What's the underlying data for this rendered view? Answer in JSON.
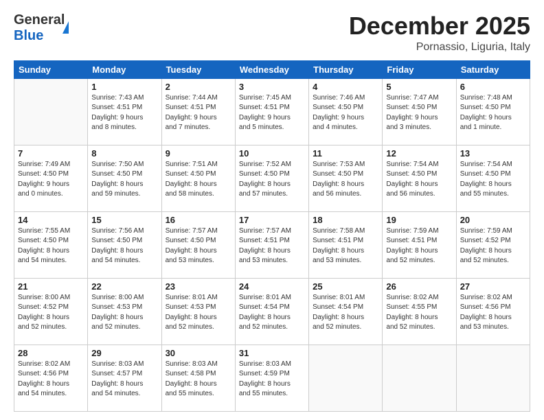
{
  "header": {
    "logo_general": "General",
    "logo_blue": "Blue",
    "month_title": "December 2025",
    "location": "Pornassio, Liguria, Italy"
  },
  "weekdays": [
    "Sunday",
    "Monday",
    "Tuesday",
    "Wednesday",
    "Thursday",
    "Friday",
    "Saturday"
  ],
  "weeks": [
    [
      {
        "day": "",
        "info": ""
      },
      {
        "day": "1",
        "info": "Sunrise: 7:43 AM\nSunset: 4:51 PM\nDaylight: 9 hours\nand 8 minutes."
      },
      {
        "day": "2",
        "info": "Sunrise: 7:44 AM\nSunset: 4:51 PM\nDaylight: 9 hours\nand 7 minutes."
      },
      {
        "day": "3",
        "info": "Sunrise: 7:45 AM\nSunset: 4:51 PM\nDaylight: 9 hours\nand 5 minutes."
      },
      {
        "day": "4",
        "info": "Sunrise: 7:46 AM\nSunset: 4:50 PM\nDaylight: 9 hours\nand 4 minutes."
      },
      {
        "day": "5",
        "info": "Sunrise: 7:47 AM\nSunset: 4:50 PM\nDaylight: 9 hours\nand 3 minutes."
      },
      {
        "day": "6",
        "info": "Sunrise: 7:48 AM\nSunset: 4:50 PM\nDaylight: 9 hours\nand 1 minute."
      }
    ],
    [
      {
        "day": "7",
        "info": "Sunrise: 7:49 AM\nSunset: 4:50 PM\nDaylight: 9 hours\nand 0 minutes."
      },
      {
        "day": "8",
        "info": "Sunrise: 7:50 AM\nSunset: 4:50 PM\nDaylight: 8 hours\nand 59 minutes."
      },
      {
        "day": "9",
        "info": "Sunrise: 7:51 AM\nSunset: 4:50 PM\nDaylight: 8 hours\nand 58 minutes."
      },
      {
        "day": "10",
        "info": "Sunrise: 7:52 AM\nSunset: 4:50 PM\nDaylight: 8 hours\nand 57 minutes."
      },
      {
        "day": "11",
        "info": "Sunrise: 7:53 AM\nSunset: 4:50 PM\nDaylight: 8 hours\nand 56 minutes."
      },
      {
        "day": "12",
        "info": "Sunrise: 7:54 AM\nSunset: 4:50 PM\nDaylight: 8 hours\nand 56 minutes."
      },
      {
        "day": "13",
        "info": "Sunrise: 7:54 AM\nSunset: 4:50 PM\nDaylight: 8 hours\nand 55 minutes."
      }
    ],
    [
      {
        "day": "14",
        "info": "Sunrise: 7:55 AM\nSunset: 4:50 PM\nDaylight: 8 hours\nand 54 minutes."
      },
      {
        "day": "15",
        "info": "Sunrise: 7:56 AM\nSunset: 4:50 PM\nDaylight: 8 hours\nand 54 minutes."
      },
      {
        "day": "16",
        "info": "Sunrise: 7:57 AM\nSunset: 4:50 PM\nDaylight: 8 hours\nand 53 minutes."
      },
      {
        "day": "17",
        "info": "Sunrise: 7:57 AM\nSunset: 4:51 PM\nDaylight: 8 hours\nand 53 minutes."
      },
      {
        "day": "18",
        "info": "Sunrise: 7:58 AM\nSunset: 4:51 PM\nDaylight: 8 hours\nand 53 minutes."
      },
      {
        "day": "19",
        "info": "Sunrise: 7:59 AM\nSunset: 4:51 PM\nDaylight: 8 hours\nand 52 minutes."
      },
      {
        "day": "20",
        "info": "Sunrise: 7:59 AM\nSunset: 4:52 PM\nDaylight: 8 hours\nand 52 minutes."
      }
    ],
    [
      {
        "day": "21",
        "info": "Sunrise: 8:00 AM\nSunset: 4:52 PM\nDaylight: 8 hours\nand 52 minutes."
      },
      {
        "day": "22",
        "info": "Sunrise: 8:00 AM\nSunset: 4:53 PM\nDaylight: 8 hours\nand 52 minutes."
      },
      {
        "day": "23",
        "info": "Sunrise: 8:01 AM\nSunset: 4:53 PM\nDaylight: 8 hours\nand 52 minutes."
      },
      {
        "day": "24",
        "info": "Sunrise: 8:01 AM\nSunset: 4:54 PM\nDaylight: 8 hours\nand 52 minutes."
      },
      {
        "day": "25",
        "info": "Sunrise: 8:01 AM\nSunset: 4:54 PM\nDaylight: 8 hours\nand 52 minutes."
      },
      {
        "day": "26",
        "info": "Sunrise: 8:02 AM\nSunset: 4:55 PM\nDaylight: 8 hours\nand 52 minutes."
      },
      {
        "day": "27",
        "info": "Sunrise: 8:02 AM\nSunset: 4:56 PM\nDaylight: 8 hours\nand 53 minutes."
      }
    ],
    [
      {
        "day": "28",
        "info": "Sunrise: 8:02 AM\nSunset: 4:56 PM\nDaylight: 8 hours\nand 54 minutes."
      },
      {
        "day": "29",
        "info": "Sunrise: 8:03 AM\nSunset: 4:57 PM\nDaylight: 8 hours\nand 54 minutes."
      },
      {
        "day": "30",
        "info": "Sunrise: 8:03 AM\nSunset: 4:58 PM\nDaylight: 8 hours\nand 55 minutes."
      },
      {
        "day": "31",
        "info": "Sunrise: 8:03 AM\nSunset: 4:59 PM\nDaylight: 8 hours\nand 55 minutes."
      },
      {
        "day": "",
        "info": ""
      },
      {
        "day": "",
        "info": ""
      },
      {
        "day": "",
        "info": ""
      }
    ]
  ]
}
